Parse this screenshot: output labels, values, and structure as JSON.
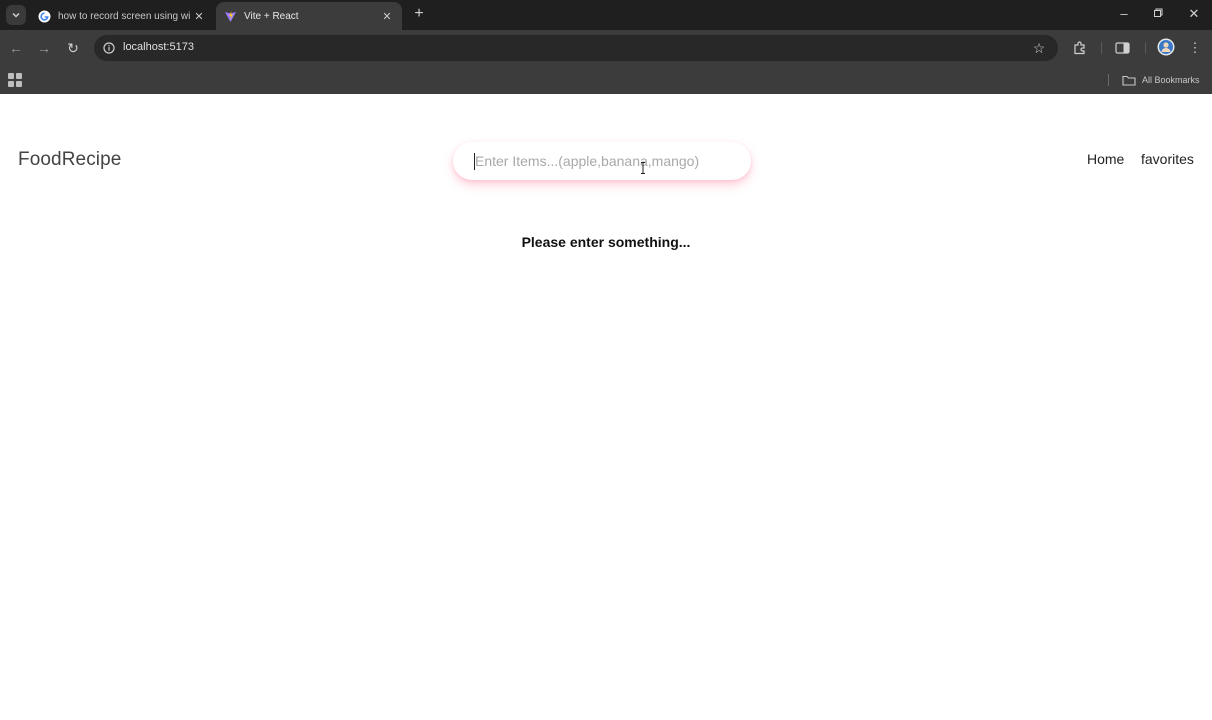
{
  "browser": {
    "tabs": [
      {
        "title": "how to record screen using wi",
        "favicon": "google-icon",
        "active": false
      },
      {
        "title": "Vite + React",
        "favicon": "vite-icon",
        "active": true
      }
    ],
    "address": "localhost:5173",
    "bookmarks_label": "All Bookmarks"
  },
  "app": {
    "logo": "FoodRecipe",
    "search": {
      "placeholder": "Enter Items...(apple,banana,mango)",
      "value": ""
    },
    "nav": [
      {
        "label": "Home"
      },
      {
        "label": "favorites"
      }
    ],
    "message": "Please enter something..."
  },
  "colors": {
    "chrome_dark": "#1f1f1f",
    "chrome_toolbar": "#3c3c3c",
    "search_shadow": "#ff7896",
    "text": "#222222"
  }
}
